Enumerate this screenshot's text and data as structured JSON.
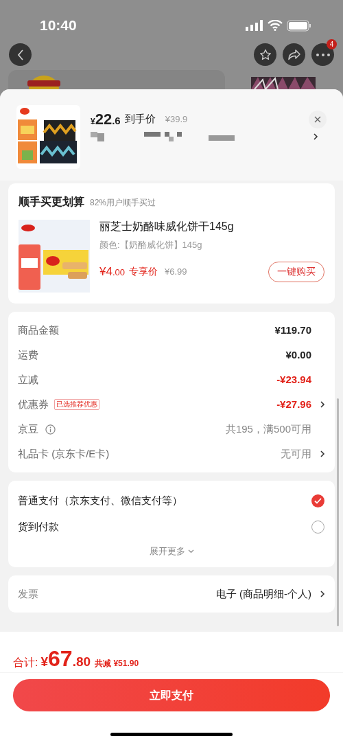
{
  "status_bar": {
    "time": "10:40"
  },
  "nav": {
    "badge": "4"
  },
  "sheet_header": {
    "currency": "¥",
    "price_int": "22",
    "price_dec": ".6",
    "price_label": "到手价",
    "original_price": "¥39.9"
  },
  "addon": {
    "title": "顺手买更划算",
    "subtitle": "82%用户顺手买过",
    "name": "丽芝士奶酪味威化饼干145g",
    "spec": "颜色:【奶酪威化饼】145g",
    "price_int": "¥4",
    "price_dec": ".00",
    "price_label": "专享价",
    "original_price": "¥6.99",
    "button": "一键购买"
  },
  "fees": [
    {
      "label": "商品金额",
      "value": "¥119.70",
      "kind": "normal",
      "chevron": false,
      "info": false
    },
    {
      "label": "运费",
      "value": "¥0.00",
      "kind": "normal",
      "chevron": false,
      "info": false
    },
    {
      "label": "立减",
      "value": "-¥23.94",
      "kind": "discount",
      "chevron": false,
      "info": false
    },
    {
      "label": "优惠券",
      "tag": "已选推荐优惠",
      "value": "-¥27.96",
      "kind": "discount",
      "chevron": true,
      "info": false
    },
    {
      "label": "京豆",
      "value": "共195，满500可用",
      "kind": "muted",
      "chevron": false,
      "info": true
    },
    {
      "label": "礼品卡 (京东卡/E卡)",
      "value": "无可用",
      "kind": "muted",
      "chevron": true,
      "info": false
    }
  ],
  "payment": {
    "options": [
      {
        "label": "普通支付（京东支付、微信支付等）",
        "selected": true
      },
      {
        "label": "货到付款",
        "selected": false
      }
    ],
    "more": "展开更多"
  },
  "invoice": {
    "label": "发票",
    "value": "电子 (商品明细-个人)"
  },
  "footer": {
    "total_label": "合计:",
    "currency": "¥",
    "total_int": "67",
    "total_dec": ".80",
    "savings": "共减 ¥51.90",
    "button": "立即支付"
  }
}
